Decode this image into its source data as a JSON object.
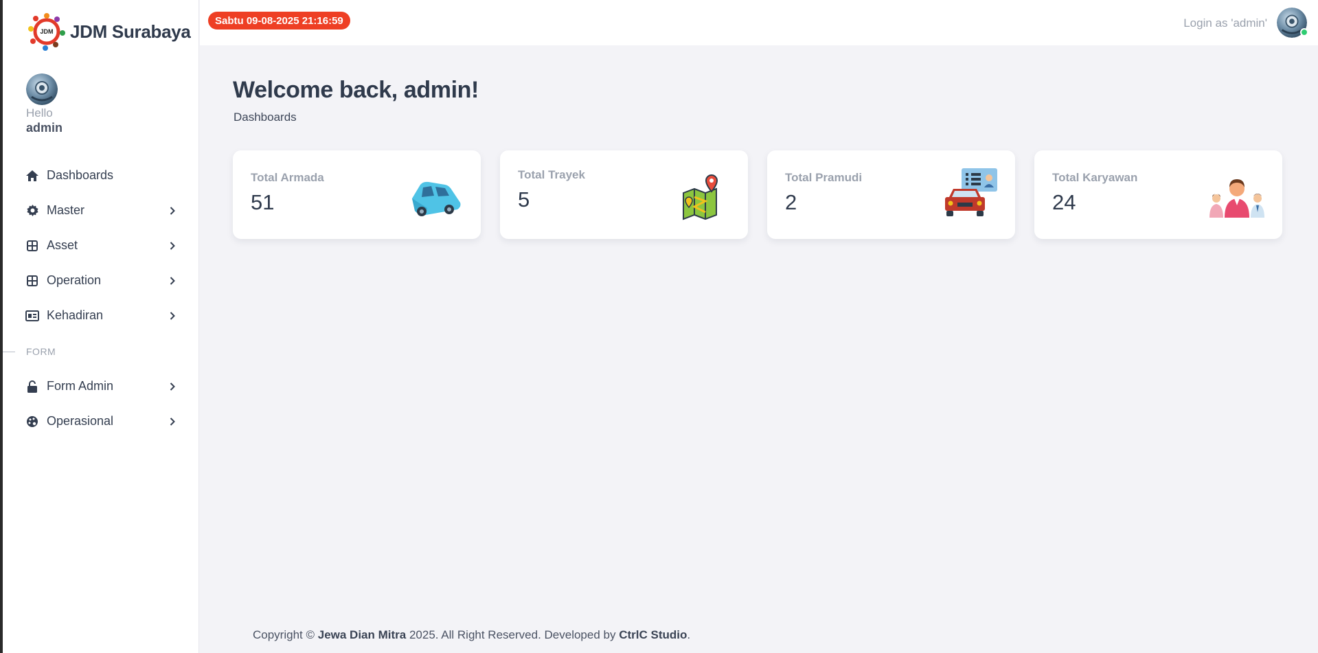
{
  "brand": {
    "name": "JDM Surabaya",
    "logo_text": "JDM"
  },
  "sidebar": {
    "hello": "Hello",
    "user": "admin",
    "items": [
      {
        "label": "Dashboards",
        "icon": "home-icon",
        "has_submenu": false
      },
      {
        "label": "Master",
        "icon": "gear-icon",
        "has_submenu": true
      },
      {
        "label": "Asset",
        "icon": "grid-icon",
        "has_submenu": true
      },
      {
        "label": "Operation",
        "icon": "grid-icon",
        "has_submenu": true
      },
      {
        "label": "Kehadiran",
        "icon": "id-card-icon",
        "has_submenu": true
      }
    ],
    "section_label": "FORM",
    "form_items": [
      {
        "label": "Form Admin",
        "icon": "lock-icon",
        "has_submenu": true
      },
      {
        "label": "Operasional",
        "icon": "palette-icon",
        "has_submenu": true
      }
    ]
  },
  "topbar": {
    "datetime": "Sabtu 09-08-2025 21:16:59",
    "login_text": "Login as 'admin'",
    "badge_color": "#ee3f24"
  },
  "main": {
    "welcome": "Welcome back, admin!",
    "breadcrumb": "Dashboards",
    "cards": [
      {
        "title": "Total Armada",
        "value": "51",
        "icon": "car-icon"
      },
      {
        "title": "Total Trayek",
        "value": "5",
        "icon": "map-icon"
      },
      {
        "title": "Total Pramudi",
        "value": "2",
        "icon": "driver-icon"
      },
      {
        "title": "Total Karyawan",
        "value": "24",
        "icon": "employees-icon"
      }
    ]
  },
  "footer": {
    "prefix": "Copyright © ",
    "company": "Jewa Dian Mitra",
    "middle": " 2025. All Right Reserved. Developed by ",
    "developer": "CtrlC Studio",
    "suffix": "."
  }
}
